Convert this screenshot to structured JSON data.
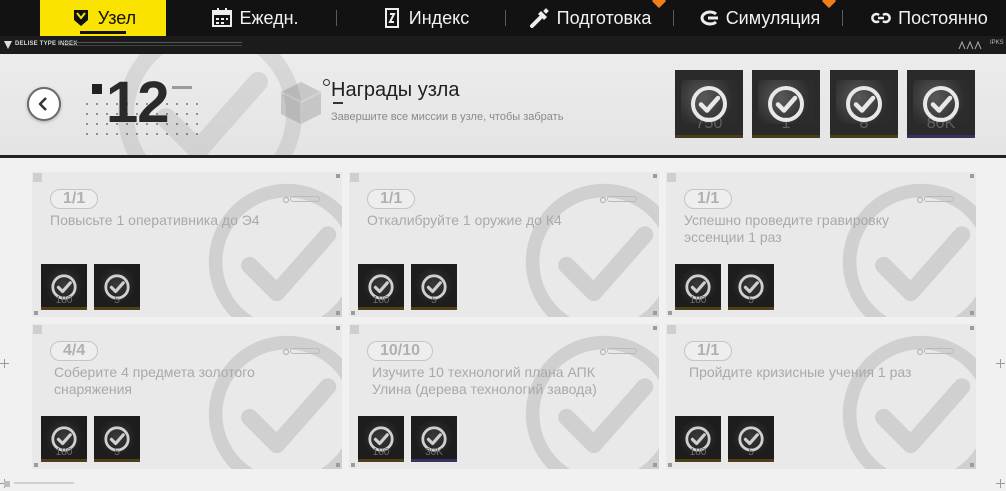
{
  "nav": {
    "tabs": [
      {
        "label": "Узел",
        "icon": "node-icon",
        "active": true
      },
      {
        "label": "Ежедн.",
        "icon": "calendar-icon",
        "active": false
      },
      {
        "label": "Индекс",
        "icon": "index-book-icon",
        "active": false
      },
      {
        "label": "Подготовка",
        "icon": "wrench-icon",
        "active": false,
        "notification": true
      },
      {
        "label": "Симуляция",
        "icon": "simulation-icon",
        "active": false,
        "notification": true
      },
      {
        "label": "Постоянно",
        "icon": "link-icon",
        "active": false
      }
    ],
    "accent_color": "#fbe300",
    "notification_color": "#ef7d1b"
  },
  "brand": {
    "name": "DELISE TYPE INDEX",
    "tag": "IPKS"
  },
  "header": {
    "node_number": "12",
    "rewards_title": "Награды узла",
    "rewards_subtitle": "Завершите все миссии в узле, чтобы забрать",
    "rewards": [
      {
        "qty": "750",
        "claimed": true
      },
      {
        "qty": "1",
        "claimed": true
      },
      {
        "qty": "8",
        "claimed": true
      },
      {
        "qty": "80K",
        "claimed": true
      }
    ]
  },
  "missions": [
    {
      "progress": "1/1",
      "description": "Повысьте 1 оперативника до Э4",
      "rewards": [
        {
          "qty": "180"
        },
        {
          "qty": "5"
        }
      ]
    },
    {
      "progress": "1/1",
      "description": "Откалибруйте 1 оружие до К4",
      "rewards": [
        {
          "qty": "180"
        },
        {
          "qty": "5"
        }
      ]
    },
    {
      "progress": "1/1",
      "description": "Успешно проведите гравировку эссенции 1 раз",
      "rewards": [
        {
          "qty": "180"
        },
        {
          "qty": "5"
        }
      ]
    },
    {
      "progress": "4/4",
      "description": "Соберите 4 предмета золотого снаряжения",
      "rewards": [
        {
          "qty": "180"
        },
        {
          "qty": "5"
        }
      ]
    },
    {
      "progress": "10/10",
      "description": "Изучите 10 технологий плана АПК Улина (дерева технологий завода)",
      "rewards": [
        {
          "qty": "180"
        },
        {
          "qty": "30K"
        }
      ]
    },
    {
      "progress": "1/1",
      "description": "Пройдите кризисные учения 1 раз",
      "rewards": [
        {
          "qty": "180"
        },
        {
          "qty": "5"
        }
      ]
    }
  ]
}
